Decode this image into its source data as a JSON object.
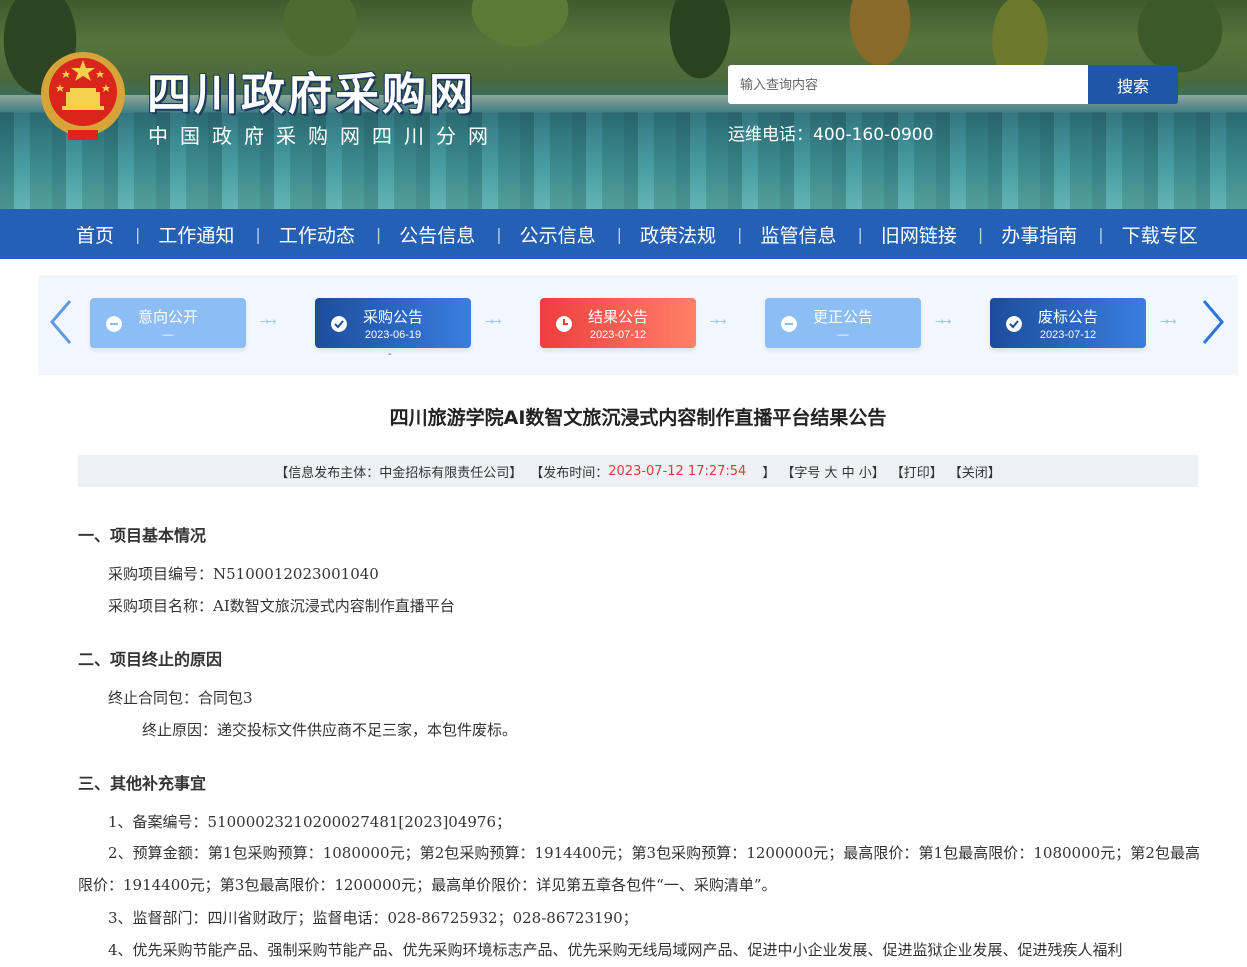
{
  "header": {
    "site_title": "四川政府采购网",
    "site_subtitle": "中国政府采购网四川分网",
    "search_placeholder": "输入查询内容",
    "search_button": "搜索",
    "hotline": "运维电话：400-160-0900"
  },
  "nav": {
    "items": [
      "首页",
      "工作通知",
      "工作动态",
      "公告信息",
      "公示信息",
      "政策法规",
      "监管信息",
      "旧网链接",
      "办事指南",
      "下载专区"
    ],
    "separator": "|"
  },
  "stepper": {
    "steps": [
      {
        "label": "意向公开",
        "date": "—",
        "style": "light",
        "icon": "minus-icon"
      },
      {
        "label": "采购公告",
        "date": "2023-06-19",
        "style": "dark",
        "icon": "check-icon"
      },
      {
        "label": "结果公告",
        "date": "2023-07-12",
        "style": "red",
        "icon": "clock-icon"
      },
      {
        "label": "更正公告",
        "date": "—",
        "style": "light",
        "icon": "minus-icon"
      },
      {
        "label": "废标公告",
        "date": "2023-07-12",
        "style": "dark",
        "icon": "check-icon"
      }
    ],
    "connector_glyph": "→→",
    "mark": "-"
  },
  "article": {
    "title": "四川旅游学院AI数智文旅沉浸式内容制作直播平台结果公告",
    "meta": {
      "publisher": "【信息发布主体：中金招标有限责任公司】",
      "time_label": "【发布时间：",
      "time_value": "2023-07-12 17:27:54",
      "time_close": "】",
      "font_size": "【字号 大 中 小】",
      "print": "【打印】",
      "close": "【关闭】"
    },
    "sections": {
      "s1_title": "一、项目基本情况",
      "s1_project_no": "采购项目编号：N5100012023001040",
      "s1_project_name": "采购项目名称：AI数智文旅沉浸式内容制作直播平台",
      "s2_title": "二、项目终止的原因",
      "s2_package": "终止合同包：合同包3",
      "s2_reason": "终止原因：递交投标文件供应商不足三家，本包件废标。",
      "s3_title": "三、其他补充事宜",
      "s3_item1": "1、备案编号：51000023210200027481[2023]04976；",
      "s3_item2": "2、预算金额：第1包采购预算：1080000元；第2包采购预算：1914400元；第3包采购预算：1200000元；最高限价：第1包最高限价：1080000元；第2包最高限价：1914400元；第3包最高限价：1200000元；最高单价限价：详见第五章各包件“一、采购清单”。",
      "s3_item3": "3、监督部门：四川省财政厅；监督电话：028-86725932；028-86723190；",
      "s3_item4": "4、优先采购节能产品、强制采购节能产品、优先采购环境标志产品、优先采购无线局域网产品、促进中小企业发展、促进监狱企业发展、促进残疾人福利"
    }
  }
}
